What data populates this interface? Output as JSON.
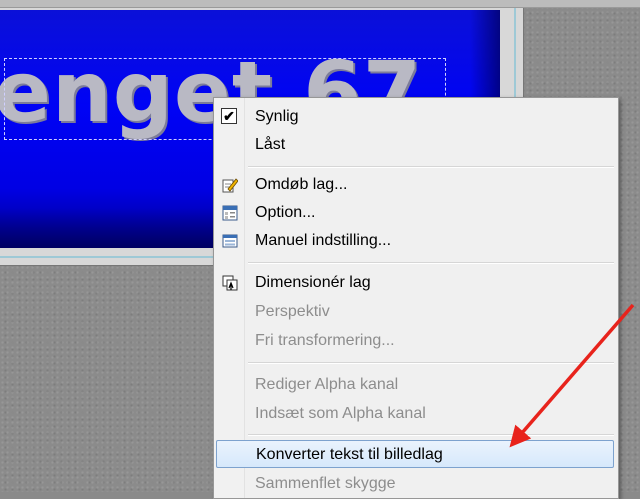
{
  "canvas_layer": {
    "text": "enget 67",
    "background_color": "#0000ee"
  },
  "context_menu": {
    "items": [
      {
        "label": "Synlig",
        "icon": "checkbox-checked-icon",
        "checked": true,
        "enabled": true
      },
      {
        "label": "Låst",
        "icon": "",
        "checked": false,
        "enabled": true
      },
      {
        "label": "Omdøb lag...",
        "icon": "rename-pencil-icon",
        "enabled": true
      },
      {
        "label": "Option...",
        "icon": "option-window-icon",
        "enabled": true
      },
      {
        "label": "Manuel indstilling...",
        "icon": "manual-settings-icon",
        "enabled": true
      },
      {
        "label": "Dimensionér lag",
        "icon": "resize-layer-icon",
        "enabled": true
      },
      {
        "label": "Perspektiv",
        "icon": "",
        "enabled": false
      },
      {
        "label": "Fri transformering...",
        "icon": "",
        "enabled": false
      },
      {
        "label": "Rediger Alpha kanal",
        "icon": "",
        "enabled": false
      },
      {
        "label": "Indsæt som Alpha kanal",
        "icon": "",
        "enabled": false
      },
      {
        "label": "Konverter tekst til billedlag",
        "icon": "",
        "enabled": true,
        "highlighted": true
      },
      {
        "label": "Sammenflet skygge",
        "icon": "",
        "enabled": false
      }
    ]
  },
  "annotation": {
    "arrow_color": "#e8231c",
    "points_to": "Konverter tekst til billedlag"
  },
  "colors": {
    "menu_bg": "#f0f0f0",
    "highlight": "#d6e8fb",
    "disabled_text": "#8d8d8d"
  }
}
